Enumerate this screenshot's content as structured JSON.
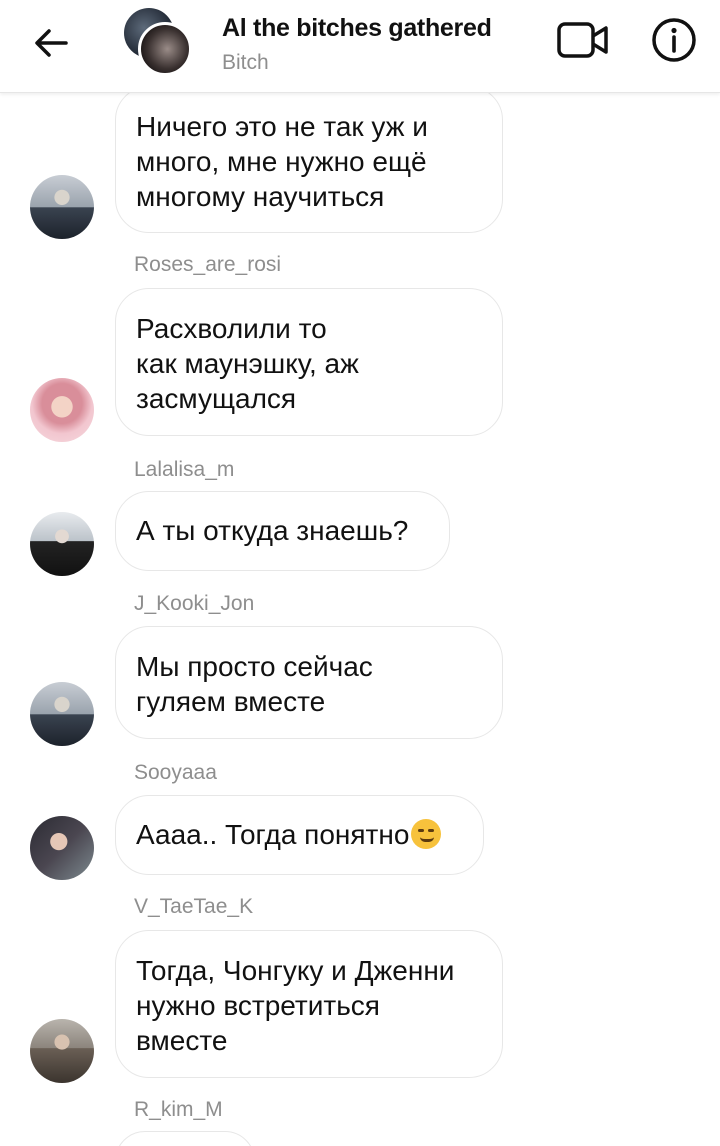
{
  "header": {
    "title": "Al the bitches gathered",
    "subtitle": "Bitch",
    "back_icon": "arrow-left-icon",
    "video_icon": "video-camera-icon",
    "info_icon": "info-icon"
  },
  "messages": [
    {
      "sender": "",
      "text": "Ничего это не так уж и много, мне нужно ещё многому научиться",
      "lines": [
        "Ничего это не так уж и",
        "много, мне нужно ещё",
        "многому научиться"
      ]
    },
    {
      "sender": "Roses_are_rosi",
      "lines": [
        "Расхволили то",
        "как маунэшку, аж",
        "засмущался"
      ]
    },
    {
      "sender": "Lalalisa_m",
      "lines": [
        "А ты откуда знаешь?"
      ]
    },
    {
      "sender": "J_Kooki_Jon",
      "lines": [
        "Мы просто сейчас",
        "гуляем вместе"
      ]
    },
    {
      "sender": "Sooyaaa",
      "lines": [
        "Аааа.. Тогда понятно"
      ],
      "emoji": "smirking-face"
    },
    {
      "sender": "V_TaeTae_K",
      "lines": [
        "Тогда, Чонгуку и Дженни",
        "нужно встретиться",
        "вместе"
      ]
    },
    {
      "sender": "R_kim_M",
      "lines": []
    }
  ],
  "colors": {
    "meta_gray": "#8e8e8e",
    "bubble_border": "#e7e7e7",
    "text": "#111111"
  }
}
